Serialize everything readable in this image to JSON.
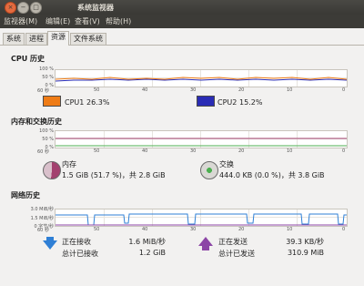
{
  "window": {
    "title": "系统监视器",
    "controls": {
      "close": "×",
      "minimize": "−",
      "maximize": "□"
    }
  },
  "menubar": {
    "items": [
      "监视器(M)",
      "编辑(E)",
      "查看(V)",
      "帮助(H)"
    ]
  },
  "tabs": [
    "系统",
    "进程",
    "资源",
    "文件系统"
  ],
  "active_tab_index": 2,
  "cpu": {
    "title": "CPU 历史",
    "y_labels": [
      "100 %",
      "50 %",
      "0 %"
    ],
    "x_labels": [
      "60 秒",
      "50",
      "40",
      "30",
      "20",
      "10",
      "0"
    ],
    "legend": [
      {
        "name": "CPU1",
        "value": "26.3%",
        "color": "#ef7c16"
      },
      {
        "name": "CPU2",
        "value": "15.2%",
        "color": "#2a2cb5"
      }
    ]
  },
  "memory": {
    "title": "内存和交换历史",
    "y_labels": [
      "100 %",
      "50 %",
      "0 %"
    ],
    "x_labels": [
      "60 秒",
      "50",
      "40",
      "30",
      "20",
      "10",
      "0"
    ],
    "memory_label": "内存",
    "memory_value": "1.5 GiB (51.7 %)，共 2.8 GiB",
    "swap_label": "交换",
    "swap_value": "444.0 KB (0.0 %)，共 3.8 GiB",
    "memory_color": "#a3416f",
    "swap_color": "#4caf50"
  },
  "network": {
    "title": "网络历史",
    "y_labels": [
      "3.0 MiB/秒",
      "1.5 MiB/秒",
      "0 字节/秒"
    ],
    "x_labels": [
      "60 秒",
      "50",
      "40",
      "30",
      "20",
      "10",
      "0"
    ],
    "receiving_label": "正在接收",
    "receiving_value": "1.6 MiB/秒",
    "received_total_label": "总计已接收",
    "received_total_value": "1.2 GiB",
    "sending_label": "正在发送",
    "sending_value": "39.3 KB/秒",
    "sent_total_label": "总计已发送",
    "sent_total_value": "310.9 MiB",
    "receive_color": "#2f7fd5",
    "send_color": "#8c46a6"
  }
}
